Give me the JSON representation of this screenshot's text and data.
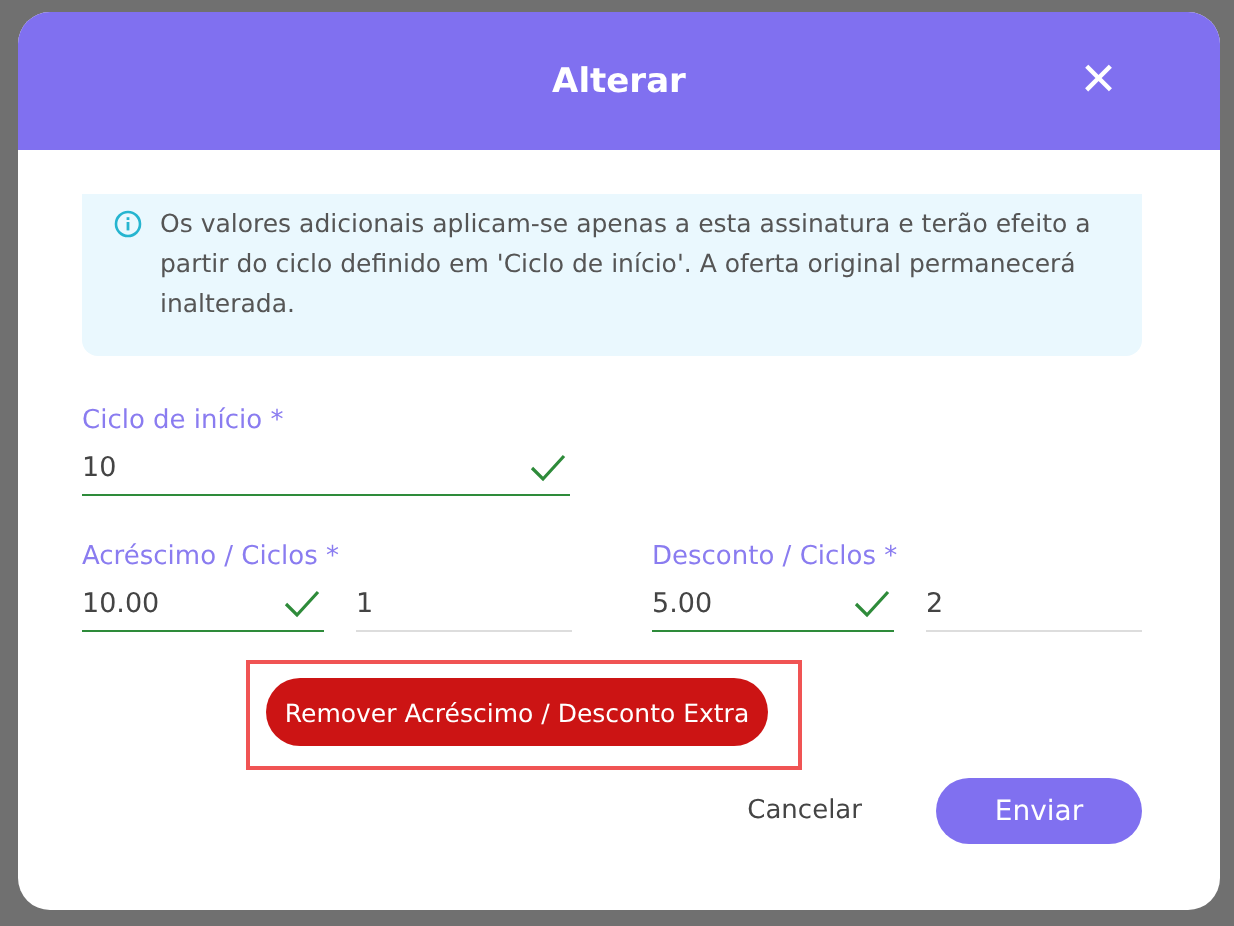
{
  "dialog": {
    "title": "Alterar",
    "close": "×",
    "info": "Os valores adicionais aplicam-se apenas a esta assinatura e terão efeito a partir do ciclo definido em 'Ciclo de início'. A oferta original permanecerá inalterada.",
    "start_cycle": {
      "label": "Ciclo de início *",
      "value": "10",
      "valid": true
    },
    "rows": [
      {
        "label": "Acréscimo / Ciclos *",
        "value": "10.00",
        "valid": true,
        "cycles": "1"
      },
      {
        "label": "Desconto / Ciclos *",
        "value": "5.00",
        "valid": true,
        "cycles": "2"
      }
    ],
    "remove_button": {
      "label": "Remover Acréscimo / Desconto Extra",
      "highlighted": true
    },
    "buttons": [
      {
        "label": "Cancelar",
        "kind": "text"
      },
      {
        "label": "Enviar",
        "kind": "primary"
      }
    ]
  }
}
